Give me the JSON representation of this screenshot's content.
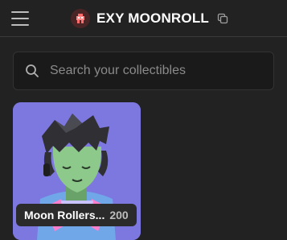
{
  "header": {
    "wallet_name": "EXY MOONROLL",
    "menu_icon": "hamburger-menu-icon",
    "avatar_icon": "pixel-avatar-icon",
    "copy_icon": "copy-icon"
  },
  "search": {
    "placeholder": "Search your collectibles",
    "value": "",
    "icon": "search-icon"
  },
  "collectibles": [
    {
      "name": "Moon Rollers...",
      "count": "200"
    }
  ],
  "colors": {
    "background": "#222222",
    "card_background": "#7d78e0",
    "search_background": "#1a1a1a"
  }
}
